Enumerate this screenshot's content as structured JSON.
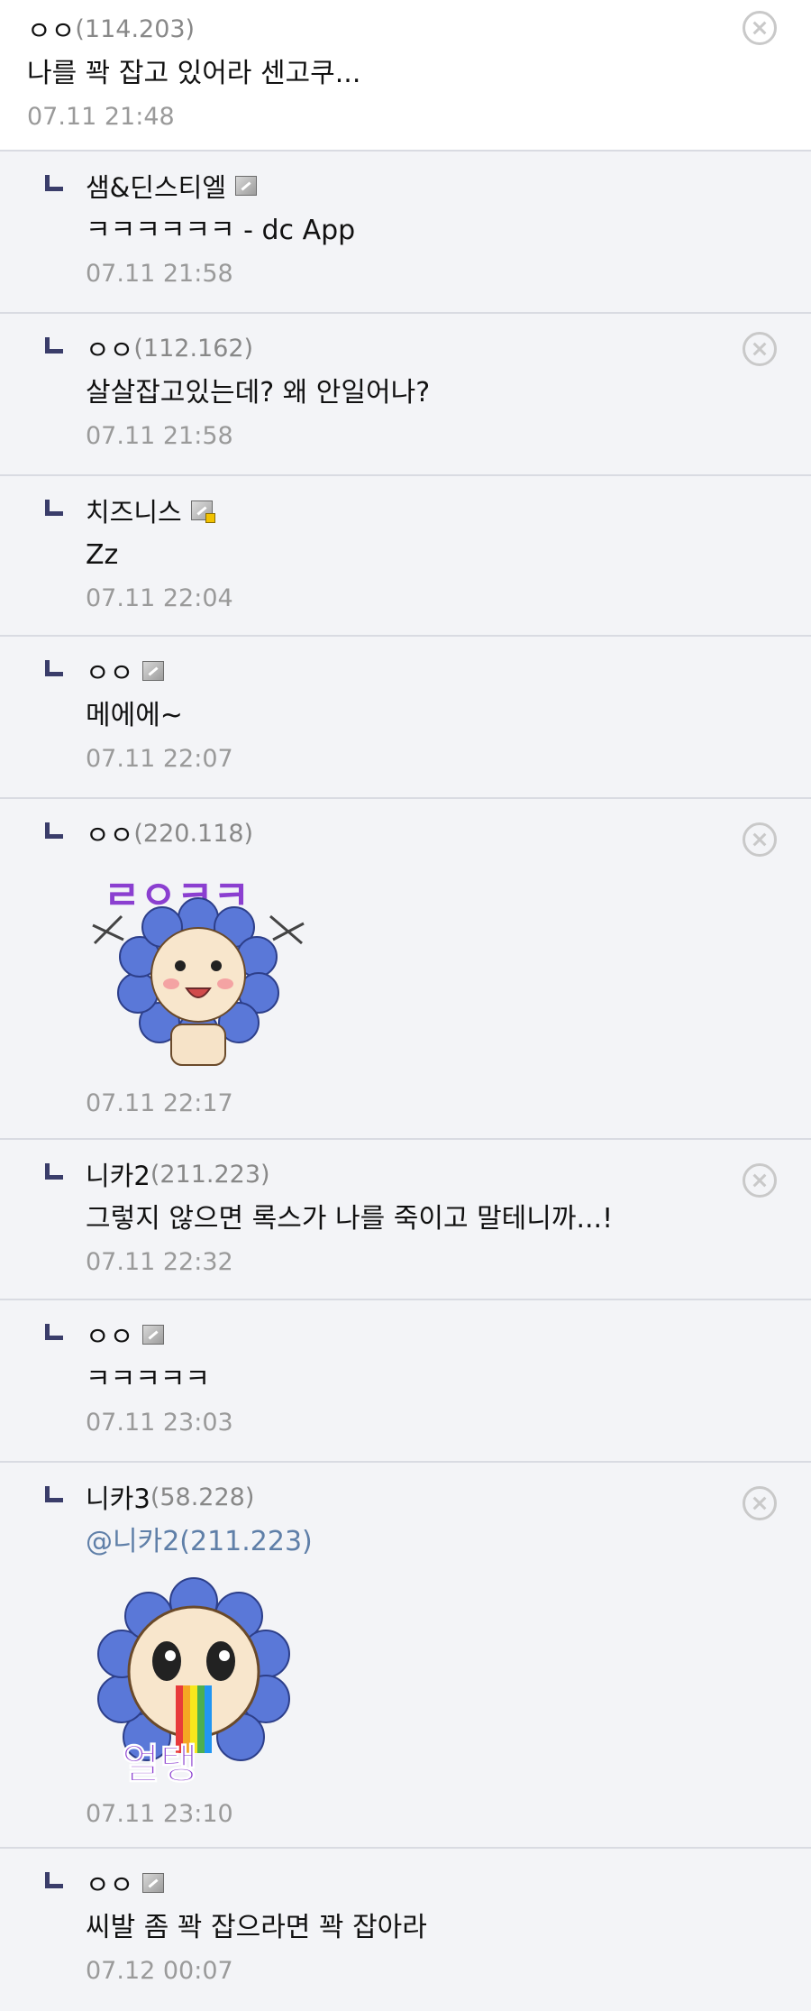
{
  "comments": [
    {
      "nick": "ㅇㅇ",
      "ip": "(114.203)",
      "text": "나를 꽉 잡고 있어라 센고쿠...",
      "date": "07.11 21:48"
    },
    {
      "nick": "샘&딘스티엘",
      "text": "ㅋㅋㅋㅋㅋㅋ - dc App",
      "date": "07.11 21:58"
    },
    {
      "nick": "ㅇㅇ",
      "ip": "(112.162)",
      "text": "살살잡고있는데? 왜 안일어나?",
      "date": "07.11 21:58"
    },
    {
      "nick": "치즈니스",
      "text": "Zz",
      "date": "07.11 22:04"
    },
    {
      "nick": "ㅇㅇ",
      "text": "메에에~",
      "date": "07.11 22:07"
    },
    {
      "nick": "ㅇㅇ",
      "ip": "(220.118)",
      "sticker_text": "ㄹㅇㅋㅋ",
      "date": "07.11 22:17"
    },
    {
      "nick": "니카2",
      "ip": "(211.223)",
      "text": "그렇지 않으면 록스가 나를 죽이고 말테니까...!",
      "date": "07.11 22:32"
    },
    {
      "nick": "ㅇㅇ",
      "text": "ㅋㅋㅋㅋㅋ",
      "date": "07.11 23:03"
    },
    {
      "nick": "니카3",
      "ip": "(58.228)",
      "mention": "@니카2(211.223)",
      "sticker_text": "얼탱",
      "date": "07.11 23:10"
    },
    {
      "nick": "ㅇㅇ",
      "text": "씨발 좀 꽉 잡으라면 꽉 잡아라",
      "date": "07.12 00:07"
    }
  ],
  "icons": {
    "reply": "reply-arrow-icon",
    "member": "gallog-member-icon",
    "delete": "delete-circle-x-icon"
  },
  "colors": {
    "reply_mark": "#3a3d6a",
    "mention": "#5f7fa8",
    "date": "#9a9a9a",
    "sticker_flower": "#5a78d8",
    "sticker_text": "#8b3fd0"
  }
}
